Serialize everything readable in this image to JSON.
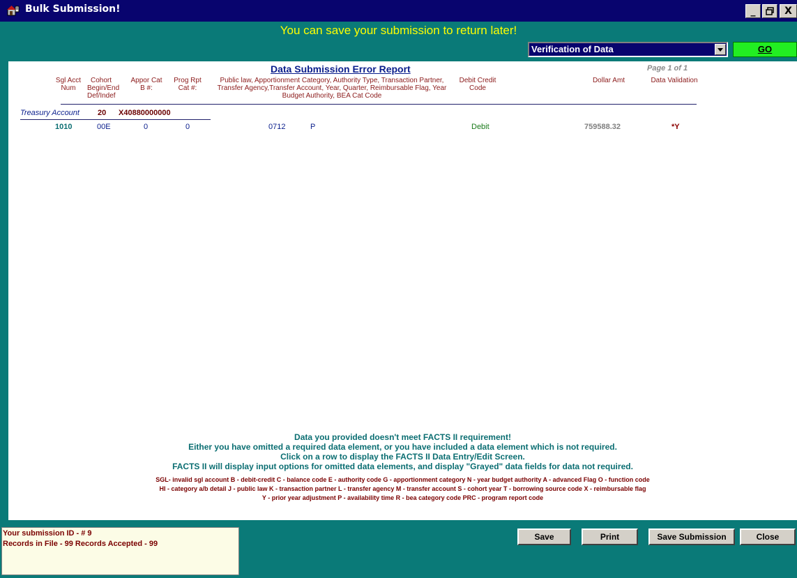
{
  "window": {
    "title": "Bulk Submission!",
    "controls": [
      "_",
      "Έ",
      "X"
    ]
  },
  "banner": "You can save your submission to return later!",
  "action_select": {
    "selected": "Verification of Data"
  },
  "go_button": {
    "label": "GO"
  },
  "report": {
    "title": "Data Submission Error Report",
    "page_indicator": "Page 1 of 1",
    "columns": {
      "sgl_acct_num": "Sgl Acct Num",
      "cohort": "Cohort Begin/End Def/Indef",
      "appor_cat": "Appor Cat B #:",
      "prog_rpt": "Prog Rpt Cat #:",
      "attributes": "Public law, Apportionment Category, Authority Type, Transaction Partner, Transfer Agency,Transfer Account, Year, Quarter, Reimbursable Flag, Year Budget Authority, BEA Cat Code",
      "debit_credit": "Debit Credit Code",
      "dollar_amt": "Dollar Amt",
      "data_validation": "Data Validation"
    },
    "treasury_account": {
      "label": "Treasury Account",
      "number": "20",
      "code": "X40880000000"
    },
    "rows": [
      {
        "sgl": "1010",
        "cohort": "00E",
        "appor_cat": "0",
        "prog_rpt": "0",
        "public_law": "0712",
        "availability": "P",
        "debit_credit": "Debit",
        "dollar_amt": "759588.32",
        "validation": "*Y"
      }
    ],
    "messages": [
      "Data you provided doesn't meet FACTS II requirement!",
      "Either you have omitted a required data element, or you have included a data element which is not required.",
      "Click on a row to display the FACTS II Data Entry/Edit Screen.",
      "FACTS II will display input options for omitted data elements, and display \"Grayed\" data fields for data not required."
    ],
    "legend": [
      "SGL- invalid sgl account  B - debit-credit  C - balance code  E - authority code  G - apportionment category N - year budget authority  A - advanced Flag  O - function code",
      "HI - category a/b detail   J - public law  K - transaction partner  L - transfer agency  M - transfer account S - cohort year T - borrowing source code  X - reimbursable flag",
      "Y - prior year adjustment P - availability time   R - bea category code  PRC - program report code"
    ]
  },
  "submission_info": {
    "id_line": "Your submission ID - # 9",
    "records_line": "Records in File - 99  Records Accepted  - 99"
  },
  "buttons": {
    "save": "Save",
    "print": "Print",
    "save_submission": "Save Submission",
    "close": "Close"
  },
  "colors": {
    "form_background": "#0a7a78",
    "title_bar": "#08046e",
    "banner_text": "#ffff00",
    "go_button": "#22ee22",
    "report_header_text": "#8b1a1a",
    "report_title": "#0a1e8c",
    "message_text": "#0b6e72",
    "legend_text": "#7a0000"
  },
  "icons": [
    "bulk-submission-app-icon",
    "minimize-icon",
    "restore-icon",
    "close-icon",
    "dropdown-arrow-icon"
  ]
}
